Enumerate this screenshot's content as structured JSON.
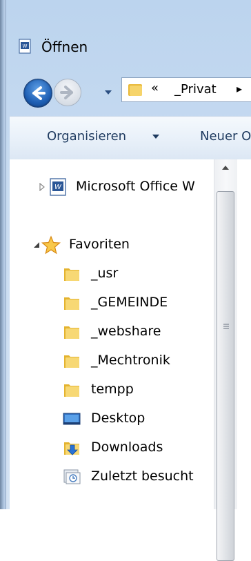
{
  "window": {
    "title": "Öffnen"
  },
  "address": {
    "chevron": "«",
    "path": "_Privat",
    "arrow": "▸"
  },
  "toolbar": {
    "organize_label": "Organisieren",
    "new_label": "Neuer O"
  },
  "tree": {
    "items": [
      {
        "label": "Microsoft Office W",
        "icon": "word-icon"
      },
      {
        "label": "Favoriten",
        "icon": "star-icon"
      },
      {
        "label": "_usr",
        "icon": "folder-icon"
      },
      {
        "label": "_GEMEINDE",
        "icon": "folder-icon"
      },
      {
        "label": "_webshare",
        "icon": "folder-icon"
      },
      {
        "label": "_Mechtronik",
        "icon": "folder-icon"
      },
      {
        "label": "tempp",
        "icon": "folder-icon"
      },
      {
        "label": "Desktop",
        "icon": "desktop-icon"
      },
      {
        "label": "Downloads",
        "icon": "downloads-icon"
      },
      {
        "label": "Zuletzt besucht",
        "icon": "recent-places-icon"
      }
    ]
  },
  "colors": {
    "title_bar": "#c9dcf1",
    "toolbar_text": "#1e3a5f",
    "folder_yellow": "#f2c94c",
    "nav_blue": "#1e5fb4"
  }
}
